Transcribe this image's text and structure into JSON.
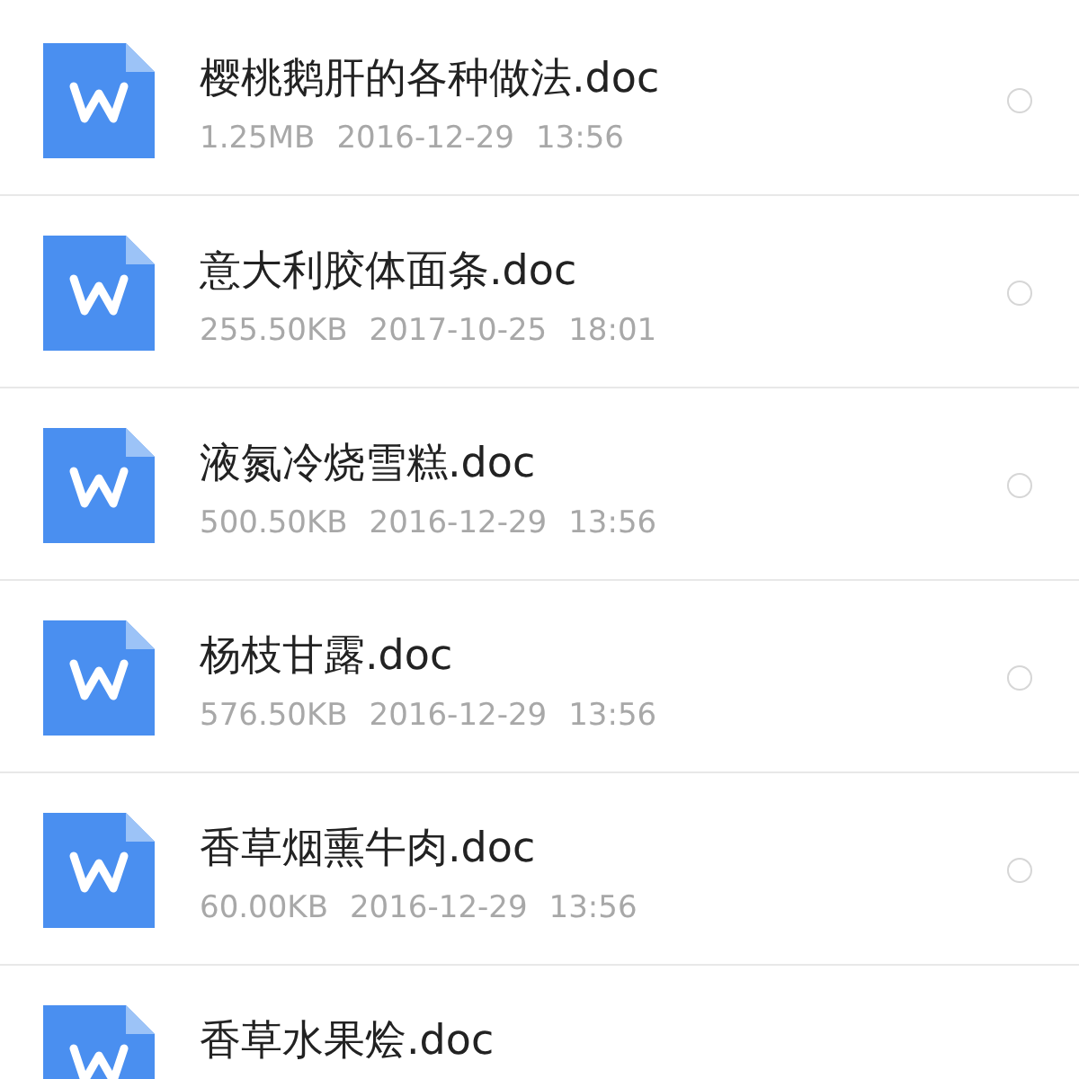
{
  "files": [
    {
      "name": "樱桃鹅肝的各种做法.doc",
      "size": "1.25MB",
      "date": "2016-12-29",
      "time": "13:56",
      "selected": false
    },
    {
      "name": "意大利胶体面条.doc",
      "size": "255.50KB",
      "date": "2017-10-25",
      "time": "18:01",
      "selected": false
    },
    {
      "name": "液氮冷烧雪糕.doc",
      "size": "500.50KB",
      "date": "2016-12-29",
      "time": "13:56",
      "selected": false
    },
    {
      "name": "杨枝甘露.doc",
      "size": "576.50KB",
      "date": "2016-12-29",
      "time": "13:56",
      "selected": false
    },
    {
      "name": "香草烟熏牛肉.doc",
      "size": "60.00KB",
      "date": "2016-12-29",
      "time": "13:56",
      "selected": false
    },
    {
      "name": "香草水果烩.doc"
    }
  ]
}
